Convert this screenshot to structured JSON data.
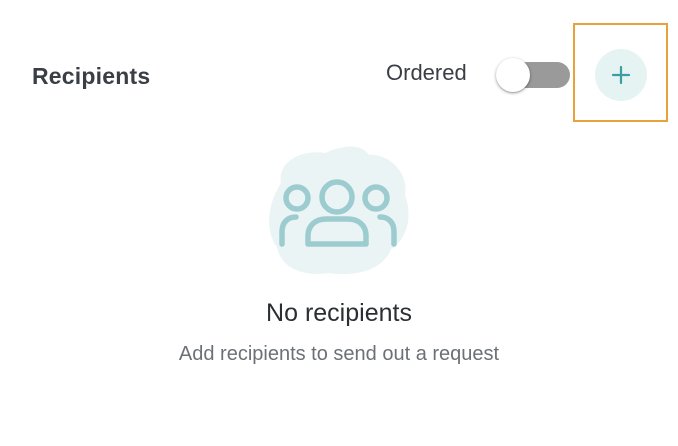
{
  "header": {
    "title": "Recipients",
    "ordered_label": "Ordered",
    "ordered_toggle_on": false
  },
  "add_button": {
    "icon": "plus-icon",
    "color": "#3a9fa3",
    "background": "#e6f3f3",
    "highlight_color": "#e9a13b"
  },
  "empty_state": {
    "icon": "people-group-icon",
    "title": "No recipients",
    "subtitle": "Add recipients to send out a request"
  }
}
